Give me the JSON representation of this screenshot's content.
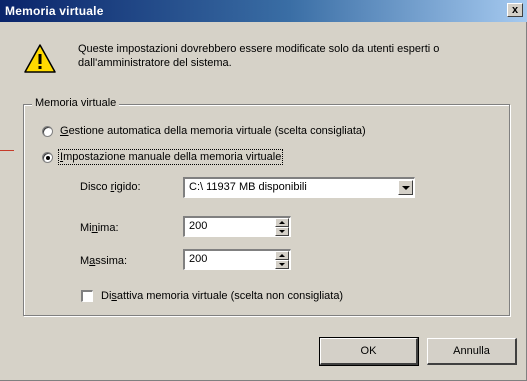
{
  "window": {
    "title": "Memoria virtuale",
    "close_label": "x"
  },
  "warning": {
    "icon": "warning-icon",
    "text": "Queste impostazioni dovrebbero essere modificate solo da utenti esperti o dall'amministratore del sistema."
  },
  "group": {
    "title": "Memoria virtuale",
    "options": [
      {
        "underline": "G",
        "label_rest": "estione automatica della memoria virtuale (scelta consigliata)",
        "selected": false
      },
      {
        "underline": "I",
        "label_rest": "mpostazione manuale della memoria virtuale",
        "selected": true
      }
    ],
    "disk": {
      "label_pre": "Disco ",
      "label_u": "r",
      "label_post": "igido:",
      "value": "C:\\ 11937 MB disponibili"
    },
    "min": {
      "label_pre": "Mi",
      "label_u": "n",
      "label_post": "ima:",
      "value": "200"
    },
    "max": {
      "label_pre": "M",
      "label_u": "a",
      "label_post": "ssima:",
      "value": "200"
    },
    "disable": {
      "label_pre": "Di",
      "label_u": "s",
      "label_post": "attiva memoria virtuale (scelta non consigliata)",
      "checked": false
    }
  },
  "buttons": {
    "ok": "OK",
    "cancel": "Annulla"
  },
  "colors": {
    "titlebar_start": "#0a246a",
    "titlebar_end": "#a6caf0",
    "dialog_bg": "#d6d2c8"
  }
}
